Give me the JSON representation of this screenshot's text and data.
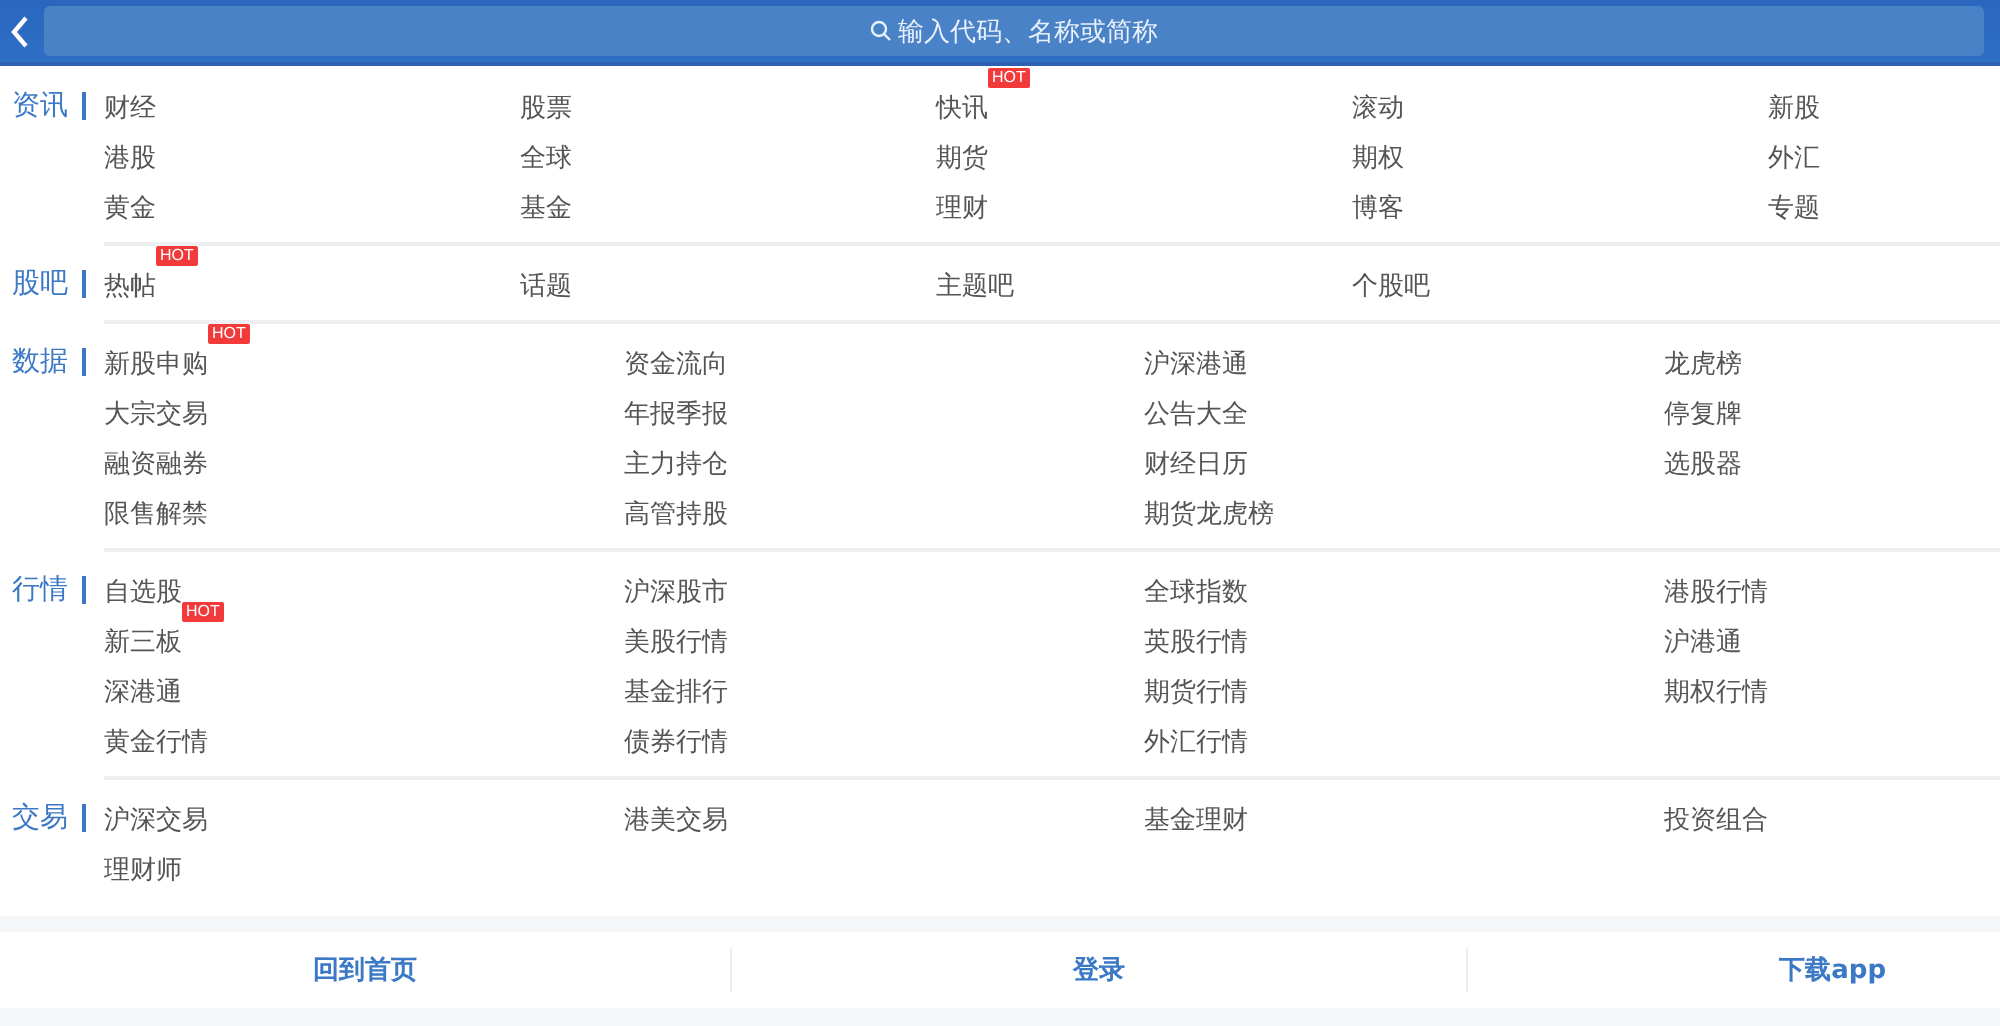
{
  "search": {
    "placeholder": "输入代码、名称或简称"
  },
  "sections": [
    {
      "label": "资讯",
      "kind": "five_column",
      "items": [
        {
          "text": "财经"
        },
        {
          "text": "股票"
        },
        {
          "text": "快讯",
          "badge": "HOT"
        },
        {
          "text": "滚动"
        },
        {
          "text": "新股"
        },
        {
          "text": "港股"
        },
        {
          "text": "全球"
        },
        {
          "text": "期货"
        },
        {
          "text": "期权"
        },
        {
          "text": "外汇"
        },
        {
          "text": "黄金"
        },
        {
          "text": "基金"
        },
        {
          "text": "理财"
        },
        {
          "text": "博客"
        },
        {
          "text": "专题"
        }
      ]
    },
    {
      "label": "股吧",
      "kind": "five_column",
      "items": [
        {
          "text": "热帖",
          "badge": "HOT"
        },
        {
          "text": "话题"
        },
        {
          "text": "主题吧"
        },
        {
          "text": "个股吧"
        }
      ]
    },
    {
      "label": "数据",
      "kind": "four_column",
      "items": [
        {
          "text": "新股申购",
          "badge": "HOT"
        },
        {
          "text": "资金流向"
        },
        {
          "text": "沪深港通"
        },
        {
          "text": "龙虎榜"
        },
        {
          "text": "大宗交易"
        },
        {
          "text": "年报季报"
        },
        {
          "text": "公告大全"
        },
        {
          "text": "停复牌"
        },
        {
          "text": "融资融券"
        },
        {
          "text": "主力持仓"
        },
        {
          "text": "财经日历"
        },
        {
          "text": "选股器"
        },
        {
          "text": "限售解禁"
        },
        {
          "text": "高管持股"
        },
        {
          "text": "期货龙虎榜"
        }
      ]
    },
    {
      "label": "行情",
      "kind": "four_column",
      "items": [
        {
          "text": "自选股"
        },
        {
          "text": "沪深股市"
        },
        {
          "text": "全球指数"
        },
        {
          "text": "港股行情"
        },
        {
          "text": "新三板",
          "badge": "HOT"
        },
        {
          "text": "美股行情"
        },
        {
          "text": "英股行情"
        },
        {
          "text": "沪港通"
        },
        {
          "text": "深港通"
        },
        {
          "text": "基金排行"
        },
        {
          "text": "期货行情"
        },
        {
          "text": "期权行情"
        },
        {
          "text": "黄金行情"
        },
        {
          "text": "债券行情"
        },
        {
          "text": "外汇行情"
        }
      ]
    },
    {
      "label": "交易",
      "kind": "four_column",
      "items": [
        {
          "text": "沪深交易"
        },
        {
          "text": "港美交易"
        },
        {
          "text": "基金理财"
        },
        {
          "text": "投资组合"
        },
        {
          "text": "理财师"
        }
      ]
    }
  ],
  "footer": [
    "回到首页",
    "登录",
    "下载app"
  ]
}
